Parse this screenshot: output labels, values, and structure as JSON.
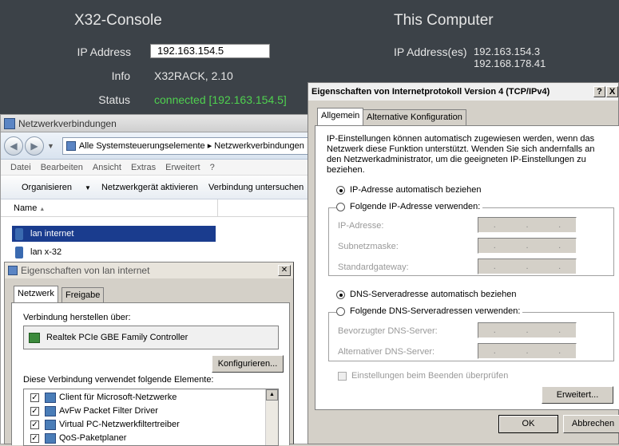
{
  "x32": {
    "left_title": "X32-Console",
    "right_title": "This Computer",
    "ip_label": "IP Address",
    "ip_value": "192.163.154.5",
    "info_label": "Info",
    "info_value": "X32RACK, 2.10",
    "status_label": "Status",
    "status_value": "connected [192.163.154.5]",
    "status_color": "#4fd14f",
    "ips_label": "IP Address(es)",
    "ips": [
      "192.163.154.3",
      "192.168.178.41"
    ]
  },
  "netwin": {
    "title": "Netzwerkverbindungen",
    "address": "Alle Systemsteuerungselemente ▸ Netzwerkverbindungen",
    "menu": [
      "Datei",
      "Bearbeiten",
      "Ansicht",
      "Extras",
      "Erweitert",
      "?"
    ],
    "commands": [
      "Organisieren",
      "Netzwerkgerät aktivieren",
      "Verbindung untersuchen",
      "V"
    ],
    "column": "Name",
    "connections": [
      "lan internet",
      "lan x-32"
    ]
  },
  "lanwin": {
    "title": "Eigenschaften von lan internet",
    "tabs": [
      "Netzwerk",
      "Freigabe"
    ],
    "connect_label": "Verbindung herstellen über:",
    "adapter": "Realtek PCIe GBE Family Controller",
    "configure_button": "Konfigurieren...",
    "elements_label": "Diese Verbindung verwendet folgende Elemente:",
    "elements": [
      "Client für Microsoft-Netzwerke",
      "AvFw Packet Filter Driver",
      "Virtual PC-Netzwerkfiltertreiber",
      "QoS-Paketplaner"
    ]
  },
  "ipwin": {
    "title": "Eigenschaften von Internetprotokoll Version 4 (TCP/IPv4)",
    "help": "?",
    "close": "X",
    "tabs": [
      "Allgemein",
      "Alternative Konfiguration"
    ],
    "intro": "IP-Einstellungen können automatisch zugewiesen werden, wenn das Netzwerk diese Funktion unterstützt. Wenden Sie sich andernfalls an den Netzwerkadministrator, um die geeigneten IP-Einstellungen zu beziehen.",
    "auto_ip": "IP-Adresse automatisch beziehen",
    "manual_ip": "Folgende IP-Adresse verwenden:",
    "ip_address": "IP-Adresse:",
    "subnet": "Subnetzmaske:",
    "gateway": "Standardgateway:",
    "auto_dns": "DNS-Serveradresse automatisch beziehen",
    "manual_dns": "Folgende DNS-Serveradressen verwenden:",
    "preferred_dns": "Bevorzugter DNS-Server:",
    "alternate_dns": "Alternativer DNS-Server:",
    "validate": "Einstellungen beim Beenden überprüfen",
    "advanced_button": "Erweitert...",
    "ok_button": "OK",
    "cancel_button": "Abbrechen"
  }
}
